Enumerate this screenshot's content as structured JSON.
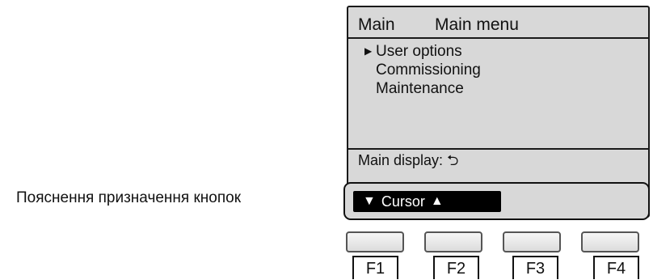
{
  "display": {
    "screen_name": "Main",
    "screen_title": "Main menu",
    "menu_items": [
      {
        "label": "User options",
        "selected": true
      },
      {
        "label": "Commissioning",
        "selected": false
      },
      {
        "label": "Maintenance",
        "selected": false
      }
    ],
    "status_text": "Main display: ⮌"
  },
  "guide": {
    "down_arrow": "▼",
    "label": "Cursor",
    "up_arrow": "▲"
  },
  "callout": {
    "text": "Пояснення призначення кнопок"
  },
  "function_keys": [
    {
      "label": "F1"
    },
    {
      "label": "F2"
    },
    {
      "label": "F3"
    },
    {
      "label": "F4"
    }
  ],
  "pointer_glyph": "▶",
  "colors": {
    "lcd_background": "#d8d8d8",
    "guide_chip": "#000000",
    "guide_text": "#ffffff"
  }
}
